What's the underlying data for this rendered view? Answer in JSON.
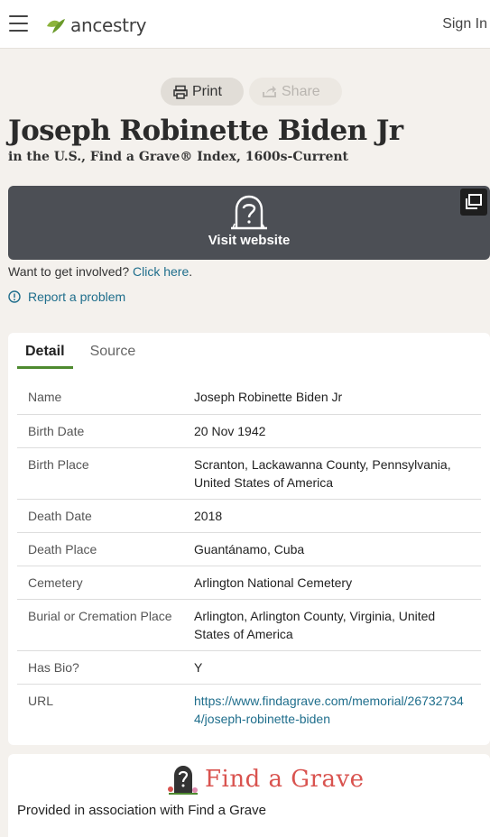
{
  "header": {
    "brand": "ancestry",
    "sign_in": "Sign In"
  },
  "actions": {
    "print": "Print",
    "share": "Share"
  },
  "record": {
    "title": "Joseph Robinette Biden Jr",
    "subtitle": "in the U.S., Find a Grave® Index, 1600s-Current"
  },
  "visit": {
    "label": "Visit website"
  },
  "involved": {
    "text": "Want to get involved?",
    "link": "Click here",
    "period": "."
  },
  "report": {
    "label": "Report a problem"
  },
  "tabs": {
    "detail": "Detail",
    "source": "Source"
  },
  "details": [
    {
      "label": "Name",
      "value": "Joseph Robinette Biden Jr"
    },
    {
      "label": "Birth Date",
      "value": "20 Nov 1942"
    },
    {
      "label": "Birth Place",
      "value": "Scranton, Lackawanna County, Pennsylvania, United States of America"
    },
    {
      "label": "Death Date",
      "value": "2018"
    },
    {
      "label": "Death Place",
      "value": "Guantánamo, Cuba"
    },
    {
      "label": "Cemetery",
      "value": "Arlington National Cemetery"
    },
    {
      "label": "Burial or Cremation Place",
      "value": "Arlington, Arlington County, Virginia, United States of America"
    },
    {
      "label": "Has Bio?",
      "value": "Y"
    },
    {
      "label": "URL",
      "value": "https://www.findagrave.com/memorial/267327344/joseph-robinette-biden"
    }
  ],
  "findagrave": {
    "logo_text": "Find a Grave",
    "provided": "Provided in association with Find a Grave"
  },
  "colors": {
    "accent_green": "#4e8a2f",
    "link_blue": "#1f6e8c",
    "banner_gray": "#4c4f55",
    "fag_red": "#d9534f"
  }
}
